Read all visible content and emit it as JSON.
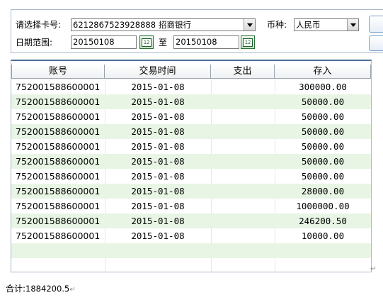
{
  "filter": {
    "card_label": "请选择卡号:",
    "card_number": "6212867523928888",
    "bank_name": "招商银行",
    "currency_label": "币种:",
    "currency_value": "人民币",
    "date_label": "日期范围:",
    "date_from": "20150108",
    "date_to_label": "至",
    "date_to": "20150108",
    "cal_icon_text": "12"
  },
  "grid": {
    "columns": [
      "账号",
      "交易时间",
      "支出",
      "存入"
    ],
    "rows": [
      {
        "account": "752001588600001",
        "time": "2015-01-08",
        "out": "",
        "in": "300000.00"
      },
      {
        "account": "752001588600001",
        "time": "2015-01-08",
        "out": "",
        "in": "50000.00"
      },
      {
        "account": "752001588600001",
        "time": "2015-01-08",
        "out": "",
        "in": "50000.00"
      },
      {
        "account": "752001588600001",
        "time": "2015-01-08",
        "out": "",
        "in": "50000.00"
      },
      {
        "account": "752001588600001",
        "time": "2015-01-08",
        "out": "",
        "in": "50000.00"
      },
      {
        "account": "752001588600001",
        "time": "2015-01-08",
        "out": "",
        "in": "50000.00"
      },
      {
        "account": "752001588600001",
        "time": "2015-01-08",
        "out": "",
        "in": "50000.00"
      },
      {
        "account": "752001588600001",
        "time": "2015-01-08",
        "out": "",
        "in": "28000.00"
      },
      {
        "account": "752001588600001",
        "time": "2015-01-08",
        "out": "",
        "in": "1000000.00"
      },
      {
        "account": "752001588600001",
        "time": "2015-01-08",
        "out": "",
        "in": "246200.50"
      },
      {
        "account": "752001588600001",
        "time": "2015-01-08",
        "out": "",
        "in": "10000.00"
      }
    ]
  },
  "summary": {
    "total_label": "合计:",
    "total_value": "1884200.5",
    "para_mark": "↵"
  },
  "colors": {
    "alt_row": "#e8f5e4",
    "header_border": "#4a6f9a"
  }
}
